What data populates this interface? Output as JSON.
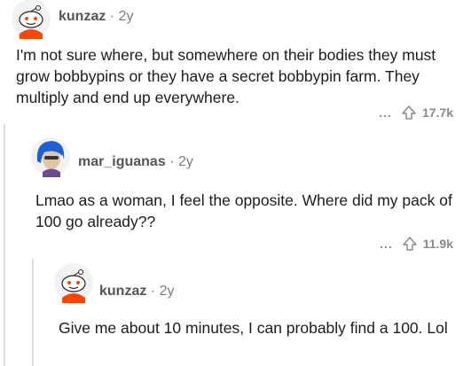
{
  "comments": [
    {
      "username": "kunzaz",
      "age": "2y",
      "text": "I'm not sure where, but somewhere on their bodies they must grow bobbypins or they have a secret bobbypin farm. They multiply and end up everywhere.",
      "more_label": "...",
      "upvotes": "17.7k",
      "avatar": "snoo-avatar-icon"
    },
    {
      "username": "mar_iguanas",
      "age": "2y",
      "text": "Lmao as a woman, I feel the opposite. Where did my pack of 100 go already??",
      "more_label": "...",
      "upvotes": "11.9k",
      "avatar": "blue-hair-avatar-icon"
    },
    {
      "username": "kunzaz",
      "age": "2y",
      "text": "Give me about 10 minutes, I can probably find a 100. Lol",
      "avatar": "snoo-avatar-icon"
    }
  ],
  "colors": {
    "thread_line": "#dcdcdc",
    "meta_text": "#555555",
    "action_text": "#878a8c",
    "body_text": "#1c1c1c"
  }
}
